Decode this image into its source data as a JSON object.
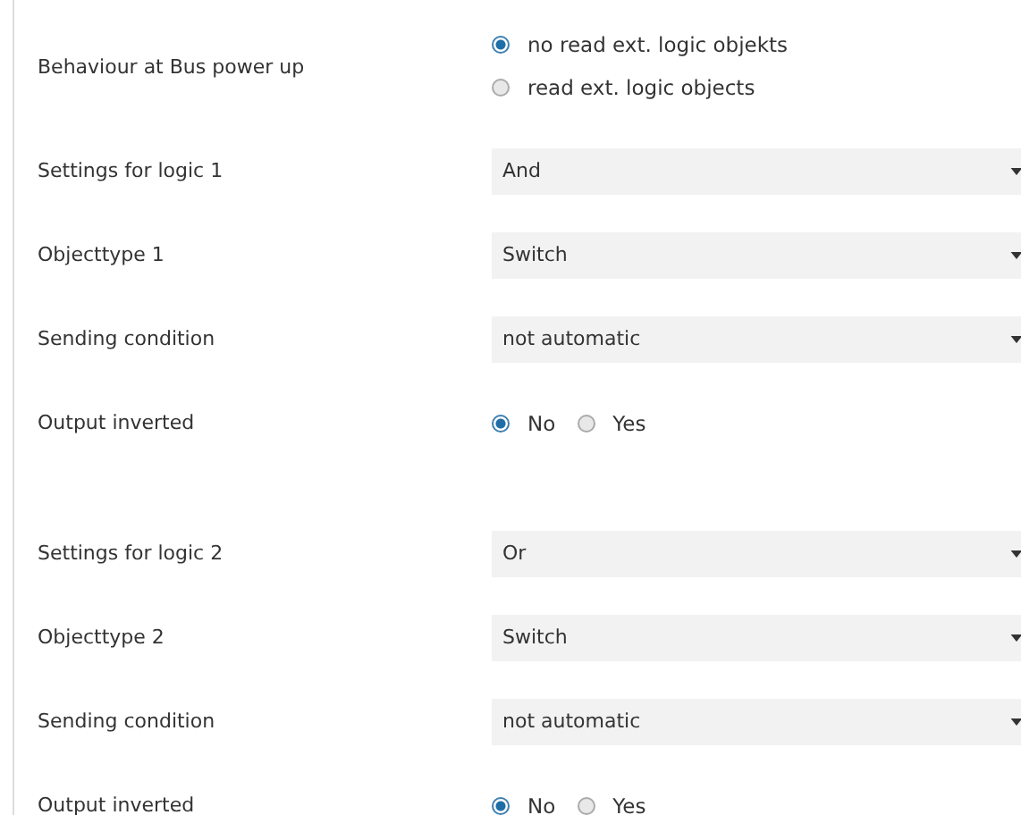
{
  "sections": [
    {
      "rows": [
        {
          "kind": "radio-stack",
          "label": "Behaviour at Bus power up",
          "options": [
            {
              "label": "no read ext. logic objekts",
              "selected": true
            },
            {
              "label": "read ext. logic objects",
              "selected": false
            }
          ]
        },
        {
          "kind": "dropdown",
          "label": "Settings for logic 1",
          "value": "And"
        },
        {
          "kind": "dropdown",
          "label": "Objecttype 1",
          "value": "Switch"
        },
        {
          "kind": "dropdown",
          "label": "Sending condition",
          "value": "not automatic"
        },
        {
          "kind": "radio-inline",
          "label": "Output inverted",
          "options": [
            {
              "label": "No",
              "selected": true
            },
            {
              "label": "Yes",
              "selected": false
            }
          ]
        }
      ]
    },
    {
      "rows": [
        {
          "kind": "dropdown",
          "label": "Settings for logic 2",
          "value": "Or"
        },
        {
          "kind": "dropdown",
          "label": "Objecttype 2",
          "value": "Switch"
        },
        {
          "kind": "dropdown",
          "label": "Sending condition",
          "value": "not automatic"
        },
        {
          "kind": "radio-inline",
          "label": "Output inverted",
          "options": [
            {
              "label": "No",
              "selected": true
            },
            {
              "label": "Yes",
              "selected": false
            }
          ]
        }
      ]
    }
  ]
}
